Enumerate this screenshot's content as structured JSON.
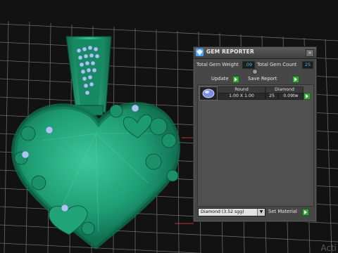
{
  "panel": {
    "title": "GEM REPORTER",
    "close_icon": "close-icon",
    "total_weight_label": "Total Gem Weight",
    "total_weight_value": ".09",
    "total_count_label": "Total Gem Count",
    "total_count_value": "25",
    "update_label": "Update",
    "save_report_label": "Save Report"
  },
  "table": {
    "headers": [
      "Round",
      "Diamond"
    ],
    "row": {
      "size": "1.00 X 1.00",
      "count": "25",
      "weight": "0.09tw"
    }
  },
  "material": {
    "selected": "Diamond    (3.52 sgg)",
    "set_label": "Set Material"
  },
  "watermark": "Acti",
  "colors": {
    "model": "#1f9e74",
    "grid": "#6c6c6c",
    "accent": "#3cc4ff",
    "go": "#3aa53a"
  }
}
